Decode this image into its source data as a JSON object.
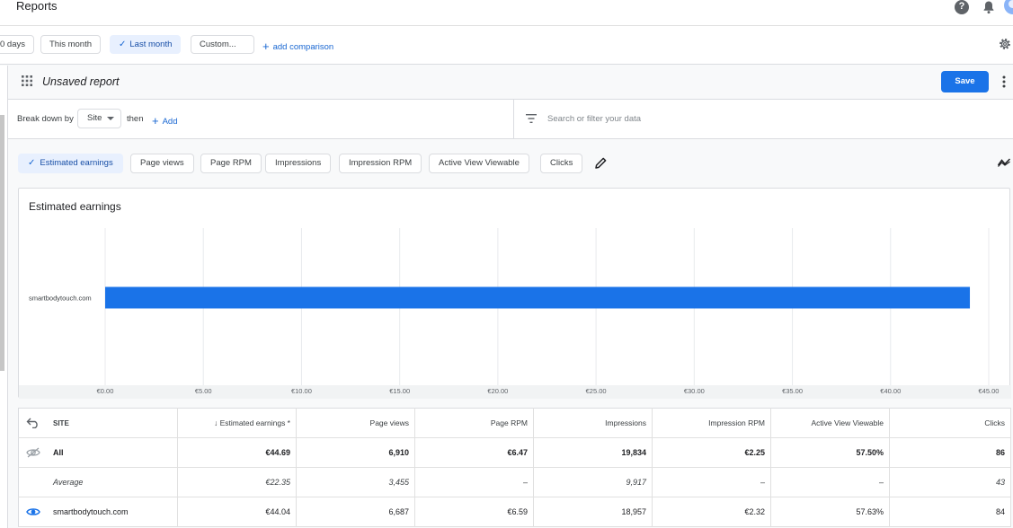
{
  "header": {
    "title": "Reports"
  },
  "date_chips": [
    {
      "label": "0 days",
      "selected": false
    },
    {
      "label": "This month",
      "selected": false
    },
    {
      "label": "Last month",
      "selected": true
    },
    {
      "label": "Custom...",
      "selected": false
    }
  ],
  "add_comparison": "add comparison",
  "report": {
    "name": "Unsaved report",
    "save_label": "Save"
  },
  "breakdown": {
    "label": "Break down by",
    "dimension": "Site",
    "then": "then",
    "add": "Add",
    "search_placeholder": "Search or filter your data"
  },
  "metric_chips": [
    {
      "label": "Estimated earnings",
      "selected": true
    },
    {
      "label": "Page views",
      "selected": false
    },
    {
      "label": "Page RPM",
      "selected": false
    },
    {
      "label": "Impressions",
      "selected": false
    },
    {
      "label": "Impression RPM",
      "selected": false
    },
    {
      "label": "Active View Viewable",
      "selected": false
    },
    {
      "label": "Clicks",
      "selected": false
    }
  ],
  "chart_data": {
    "type": "bar",
    "orientation": "horizontal",
    "title": "Estimated earnings",
    "categories": [
      "smartbodytouch.com"
    ],
    "values": [
      44.04
    ],
    "xlim": [
      0,
      45
    ],
    "x_ticks": [
      "€0.00",
      "€5.00",
      "€10.00",
      "€15.00",
      "€20.00",
      "€25.00",
      "€30.00",
      "€35.00",
      "€40.00",
      "€45.00"
    ],
    "grid": true,
    "bar_color": "#1a73e8"
  },
  "table": {
    "columns": [
      "SITE",
      "Estimated earnings *",
      "Page views",
      "Page RPM",
      "Impressions",
      "Impression RPM",
      "Active View Viewable",
      "Clicks"
    ],
    "rows": [
      {
        "kind": "total",
        "icon": "hidden-eye-icon",
        "cells": [
          "All",
          "€44.69",
          "6,910",
          "€6.47",
          "19,834",
          "€2.25",
          "57.50%",
          "86"
        ]
      },
      {
        "kind": "avg",
        "icon": "",
        "cells": [
          "Average",
          "€22.35",
          "3,455",
          "–",
          "9,917",
          "–",
          "–",
          "43"
        ]
      },
      {
        "kind": "row",
        "icon": "eye-icon",
        "cells": [
          "smartbodytouch.com",
          "€44.04",
          "6,687",
          "€6.59",
          "18,957",
          "€2.32",
          "57.63%",
          "84"
        ]
      }
    ]
  }
}
